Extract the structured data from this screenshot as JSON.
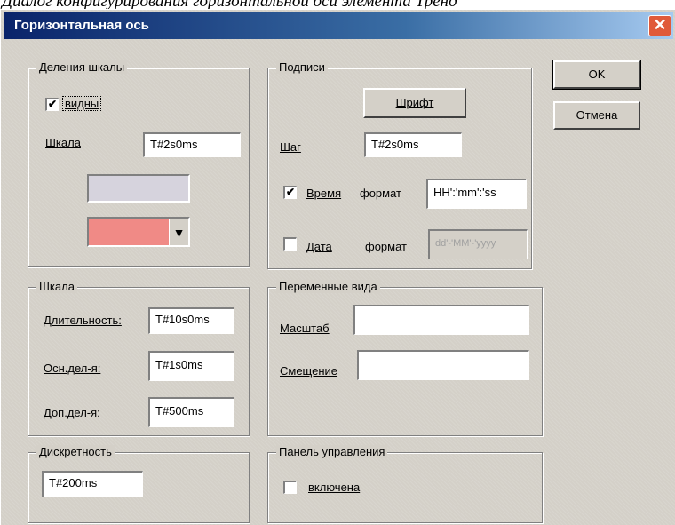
{
  "caption": "Диалог конфигурирования горизонтальной оси элемента Тренд",
  "window": {
    "title": "Горизонтальная ось",
    "close_glyph": "✕"
  },
  "buttons": {
    "ok": "OK",
    "cancel": "Отмена"
  },
  "tick_group": {
    "title": "Деления шкалы",
    "visible_label": "видны",
    "visible_checked": true,
    "scale_label": "Шкала",
    "scale_value": "T#2s0ms",
    "swatch_color": "#d6d3dd",
    "dropdown_color": "#f08a86",
    "dropdown_arrow": "▼"
  },
  "labels_group": {
    "title": "Подписи",
    "font_button": "Шрифт",
    "step_label": "Шаг",
    "step_value": "T#2s0ms",
    "time_label": "Время",
    "time_checked": true,
    "time_format_label": "формат",
    "time_format_value": "HH':'mm':'ss",
    "date_label": "Дата",
    "date_checked": false,
    "date_format_label": "формат",
    "date_format_value": "dd'-'MM'-'yyyy"
  },
  "scale_group": {
    "title": "Шкала",
    "duration_label": "Длительность:",
    "duration_value": "T#10s0ms",
    "main_div_label": "Осн.дел-я:",
    "main_div_value": "T#1s0ms",
    "aux_div_label": "Доп.дел-я:",
    "aux_div_value": "T#500ms"
  },
  "view_vars_group": {
    "title": "Переменные вида",
    "scale_label": "Масштаб",
    "scale_value": "",
    "offset_label": "Смещение",
    "offset_value": ""
  },
  "resolution_group": {
    "title": "Дискретность",
    "value": "T#200ms"
  },
  "control_panel_group": {
    "title": "Панель управления",
    "enabled_label": "включена",
    "enabled_checked": false
  },
  "icons": {
    "check_glyph": "✔"
  }
}
